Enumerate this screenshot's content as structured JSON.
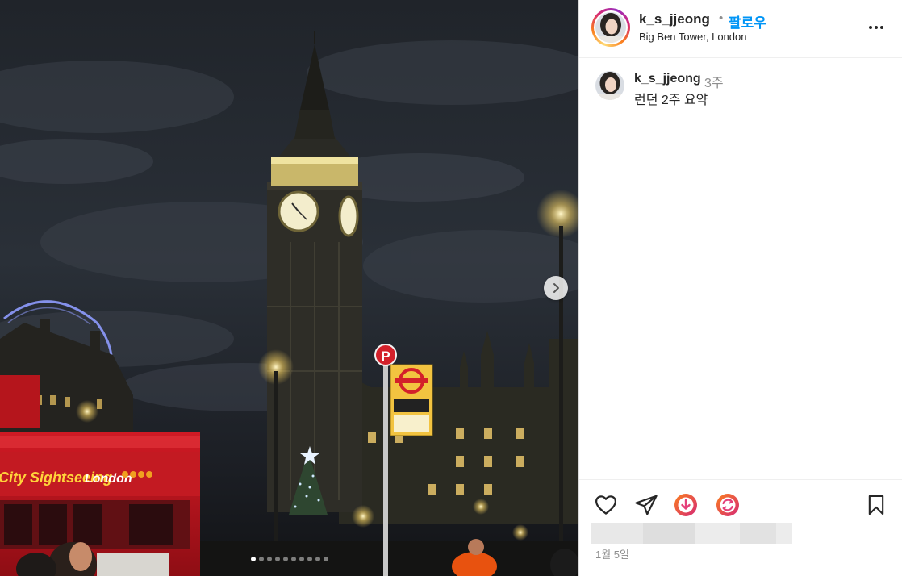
{
  "header": {
    "username": "k_s_jjeong",
    "separator": "•",
    "follow_label": "팔로우",
    "location": "Big Ben Tower, London"
  },
  "caption": {
    "username": "k_s_jjeong",
    "time_ago": "3주",
    "text": "런던 2주 요약"
  },
  "post_date": "1월 5일",
  "photo": {
    "sign_brand": "City Sightseeing",
    "sign_city": "London",
    "parking_letter": "P"
  },
  "carousel": {
    "total": 10,
    "active": 1
  },
  "icons": {
    "more": "more-options-icon",
    "like": "heart-icon",
    "share": "paper-plane-icon",
    "download": "download-icon",
    "repost": "repost-icon",
    "save": "bookmark-icon",
    "next": "chevron-right-icon"
  },
  "colors": {
    "follow": "#0095f6",
    "text": "#262626",
    "muted": "#8e8e8e",
    "gradient_a": "#fa7e1e",
    "gradient_b": "#d62976"
  }
}
